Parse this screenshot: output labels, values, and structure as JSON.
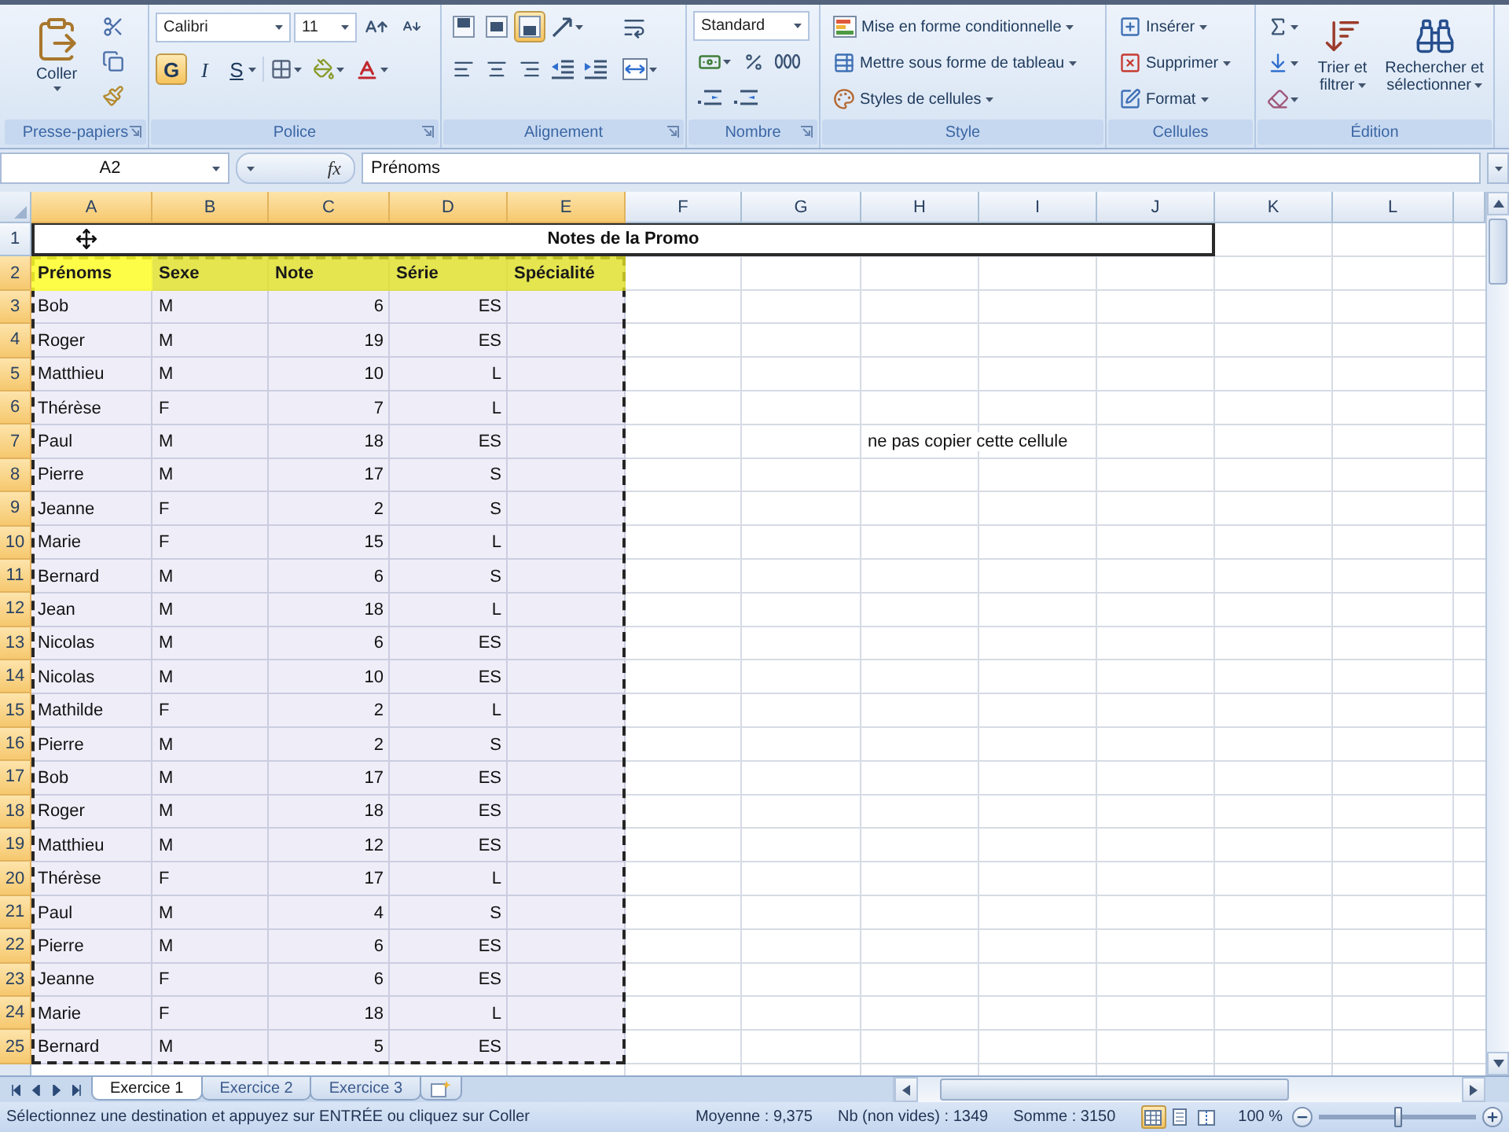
{
  "ribbon": {
    "groups": [
      {
        "kind": "clipboard",
        "label": "Presse-papiers",
        "paste_label": "Coller"
      },
      {
        "kind": "font",
        "label": "Police",
        "font_name": "Calibri",
        "font_size": "11",
        "buttons": [
          {
            "label": "G",
            "on": true
          },
          {
            "label": "I",
            "on": false
          },
          {
            "label": "S",
            "on": false
          }
        ]
      },
      {
        "kind": "alignment",
        "label": "Alignement",
        "vertical": [
          {
            "selected": false
          },
          {
            "selected": false
          },
          {
            "selected": true
          }
        ]
      },
      {
        "kind": "number",
        "label": "Nombre",
        "format": "Standard"
      },
      {
        "kind": "style",
        "label": "Style",
        "commands": [
          "Mise en forme conditionnelle",
          "Mettre sous forme de tableau",
          "Styles de cellules"
        ]
      },
      {
        "kind": "cells",
        "label": "Cellules",
        "commands": [
          "Insérer",
          "Supprimer",
          "Format"
        ]
      },
      {
        "kind": "editing",
        "label": "Édition",
        "commands": [
          "Trier et filtrer",
          "Rechercher et sélectionner"
        ]
      }
    ]
  },
  "formula_bar": {
    "name_box": "A2",
    "function_label": "fx",
    "content": "Prénoms"
  },
  "sheet": {
    "copy_marquee": true,
    "columns": [
      {
        "label": "A",
        "selected": true
      },
      {
        "label": "B",
        "selected": true
      },
      {
        "label": "C",
        "selected": true
      },
      {
        "label": "D",
        "selected": true
      },
      {
        "label": "E",
        "selected": true
      },
      {
        "label": "F",
        "selected": false
      },
      {
        "label": "G",
        "selected": false
      },
      {
        "label": "H",
        "selected": false
      },
      {
        "label": "I",
        "selected": false
      },
      {
        "label": "J",
        "selected": false
      },
      {
        "label": "K",
        "selected": false
      },
      {
        "label": "L",
        "selected": false
      }
    ],
    "rows": [
      {
        "number": "1",
        "selected": false,
        "kind": "title",
        "text": "Notes de la Promo"
      },
      {
        "number": "2",
        "selected": true,
        "kind": "header",
        "cells": [
          "Prénoms",
          "Sexe",
          "Note",
          "Série",
          "Spécialité"
        ]
      },
      {
        "number": "3",
        "selected": true,
        "kind": "data",
        "cells": [
          "Bob",
          "M",
          "6",
          "ES"
        ]
      },
      {
        "number": "4",
        "selected": true,
        "kind": "data",
        "cells": [
          "Roger",
          "M",
          "19",
          "ES"
        ]
      },
      {
        "number": "5",
        "selected": true,
        "kind": "data",
        "cells": [
          "Matthieu",
          "M",
          "10",
          "L"
        ]
      },
      {
        "number": "6",
        "selected": true,
        "kind": "data",
        "cells": [
          "Thérèse",
          "F",
          "7",
          "L"
        ]
      },
      {
        "number": "7",
        "selected": true,
        "kind": "data",
        "cells": [
          "Paul",
          "M",
          "18",
          "ES"
        ],
        "note": "ne pas copier cette cellule"
      },
      {
        "number": "8",
        "selected": true,
        "kind": "data",
        "cells": [
          "Pierre",
          "M",
          "17",
          "S"
        ]
      },
      {
        "number": "9",
        "selected": true,
        "kind": "data",
        "cells": [
          "Jeanne",
          "F",
          "2",
          "S"
        ]
      },
      {
        "number": "10",
        "selected": true,
        "kind": "data",
        "cells": [
          "Marie",
          "F",
          "15",
          "L"
        ]
      },
      {
        "number": "11",
        "selected": true,
        "kind": "data",
        "cells": [
          "Bernard",
          "M",
          "6",
          "S"
        ]
      },
      {
        "number": "12",
        "selected": true,
        "kind": "data",
        "cells": [
          "Jean",
          "M",
          "18",
          "L"
        ]
      },
      {
        "number": "13",
        "selected": true,
        "kind": "data",
        "cells": [
          "Nicolas",
          "M",
          "6",
          "ES"
        ]
      },
      {
        "number": "14",
        "selected": true,
        "kind": "data",
        "cells": [
          "Nicolas",
          "M",
          "10",
          "ES"
        ]
      },
      {
        "number": "15",
        "selected": true,
        "kind": "data",
        "cells": [
          "Mathilde",
          "F",
          "2",
          "L"
        ]
      },
      {
        "number": "16",
        "selected": true,
        "kind": "data",
        "cells": [
          "Pierre",
          "M",
          "2",
          "S"
        ]
      },
      {
        "number": "17",
        "selected": true,
        "kind": "data",
        "cells": [
          "Bob",
          "M",
          "17",
          "ES"
        ]
      },
      {
        "number": "18",
        "selected": true,
        "kind": "data",
        "cells": [
          "Roger",
          "M",
          "18",
          "ES"
        ]
      },
      {
        "number": "19",
        "selected": true,
        "kind": "data",
        "cells": [
          "Matthieu",
          "M",
          "12",
          "ES"
        ]
      },
      {
        "number": "20",
        "selected": true,
        "kind": "data",
        "cells": [
          "Thérèse",
          "F",
          "17",
          "L"
        ]
      },
      {
        "number": "21",
        "selected": true,
        "kind": "data",
        "cells": [
          "Paul",
          "M",
          "4",
          "S"
        ]
      },
      {
        "number": "22",
        "selected": true,
        "kind": "data",
        "cells": [
          "Pierre",
          "M",
          "6",
          "ES"
        ]
      },
      {
        "number": "23",
        "selected": true,
        "kind": "data",
        "cells": [
          "Jeanne",
          "F",
          "6",
          "ES"
        ]
      },
      {
        "number": "24",
        "selected": true,
        "kind": "data",
        "cells": [
          "Marie",
          "F",
          "18",
          "L"
        ]
      },
      {
        "number": "25",
        "selected": true,
        "kind": "data",
        "cells": [
          "Bernard",
          "M",
          "5",
          "ES"
        ]
      }
    ]
  },
  "sheet_tabs": [
    {
      "label": "Exercice 1",
      "selected": true
    },
    {
      "label": "Exercice 2",
      "selected": false
    },
    {
      "label": "Exercice 3",
      "selected": false
    }
  ],
  "status_bar": {
    "message": "Sélectionnez une destination et appuyez sur ENTRÉE ou cliquez sur Coller",
    "stats": [
      "Moyenne : 9,375",
      "Nb (non vides) : 1349",
      "Somme : 3150"
    ],
    "views": [
      {
        "selected": true
      },
      {
        "selected": false
      },
      {
        "selected": false
      }
    ],
    "zoom": "100 %",
    "zoom_slider": {
      "level": 0.5
    }
  }
}
